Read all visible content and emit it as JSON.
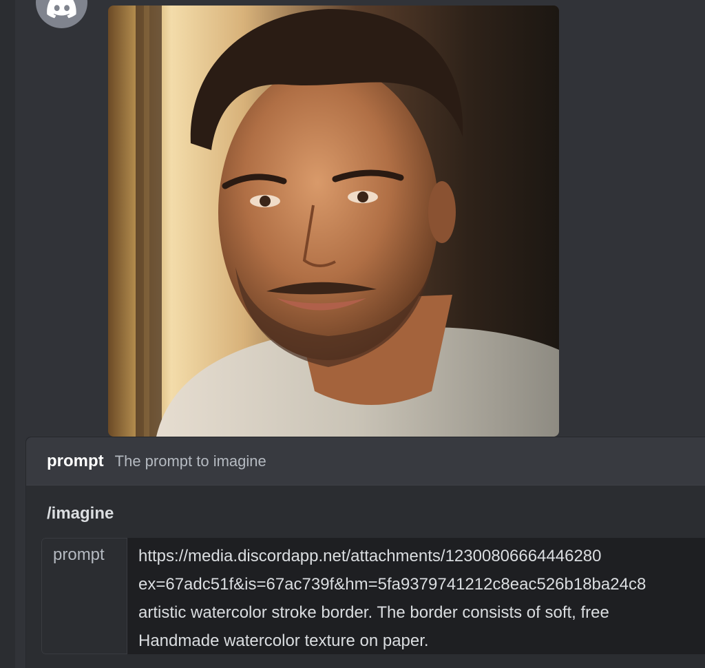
{
  "message": {
    "attachment_alt": "portrait"
  },
  "autocomplete": {
    "option_name": "prompt",
    "option_description": "The prompt to imagine",
    "command": "/imagine",
    "param_label": "prompt",
    "param_lines": [
      "https://media.discordapp.net/attachments/12300806664446280",
      "ex=67adc51f&is=67ac739f&hm=5fa9379741212c8eac526b18ba24c8",
      "artistic watercolor stroke border. The border consists of soft, free",
      "Handmade watercolor texture on paper."
    ]
  },
  "colors": {
    "background": "#313338",
    "panel": "#2b2d31",
    "header": "#383a40",
    "input": "#1e1f22"
  }
}
